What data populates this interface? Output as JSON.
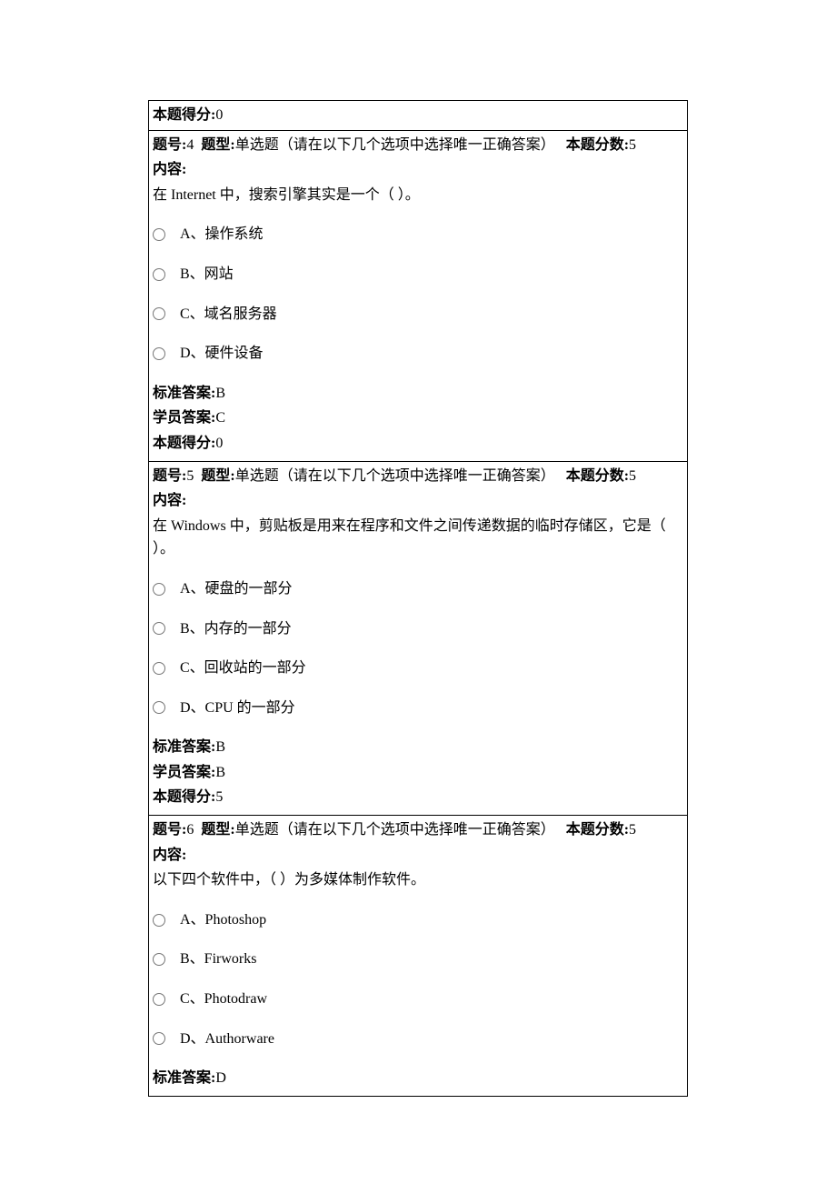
{
  "labels": {
    "score_label": "本题得分:",
    "qnum_label": "题号:",
    "qtype_label": "题型:",
    "qpoints_label": "本题分数:",
    "content_label": "内容:",
    "correct_label": "标准答案:",
    "student_label": "学员答案:"
  },
  "top_score_row": {
    "score": "0"
  },
  "questions": [
    {
      "num": "4",
      "type_text": "单选题（请在以下几个选项中选择唯一正确答案）",
      "points": "5",
      "stem": "在 Internet 中，搜索引擎其实是一个（ ）。",
      "options": [
        "A、操作系统",
        "B、网站",
        "C、域名服务器",
        "D、硬件设备"
      ],
      "correct": "B",
      "student": "C",
      "score": "0"
    },
    {
      "num": "5",
      "type_text": "单选题（请在以下几个选项中选择唯一正确答案）",
      "points": "5",
      "stem": "在 Windows 中，剪贴板是用来在程序和文件之间传递数据的临时存储区，它是（ ）。",
      "options": [
        "A、硬盘的一部分",
        "B、内存的一部分",
        "C、回收站的一部分",
        "D、CPU 的一部分"
      ],
      "correct": "B",
      "student": "B",
      "score": "5"
    },
    {
      "num": "6",
      "type_text": "单选题（请在以下几个选项中选择唯一正确答案）",
      "points": "5",
      "stem": "以下四个软件中，（ ）为多媒体制作软件。",
      "options": [
        "A、Photoshop",
        "B、Firworks",
        "C、Photodraw",
        "D、Authorware"
      ],
      "correct": "D",
      "student": null,
      "score": null
    }
  ]
}
